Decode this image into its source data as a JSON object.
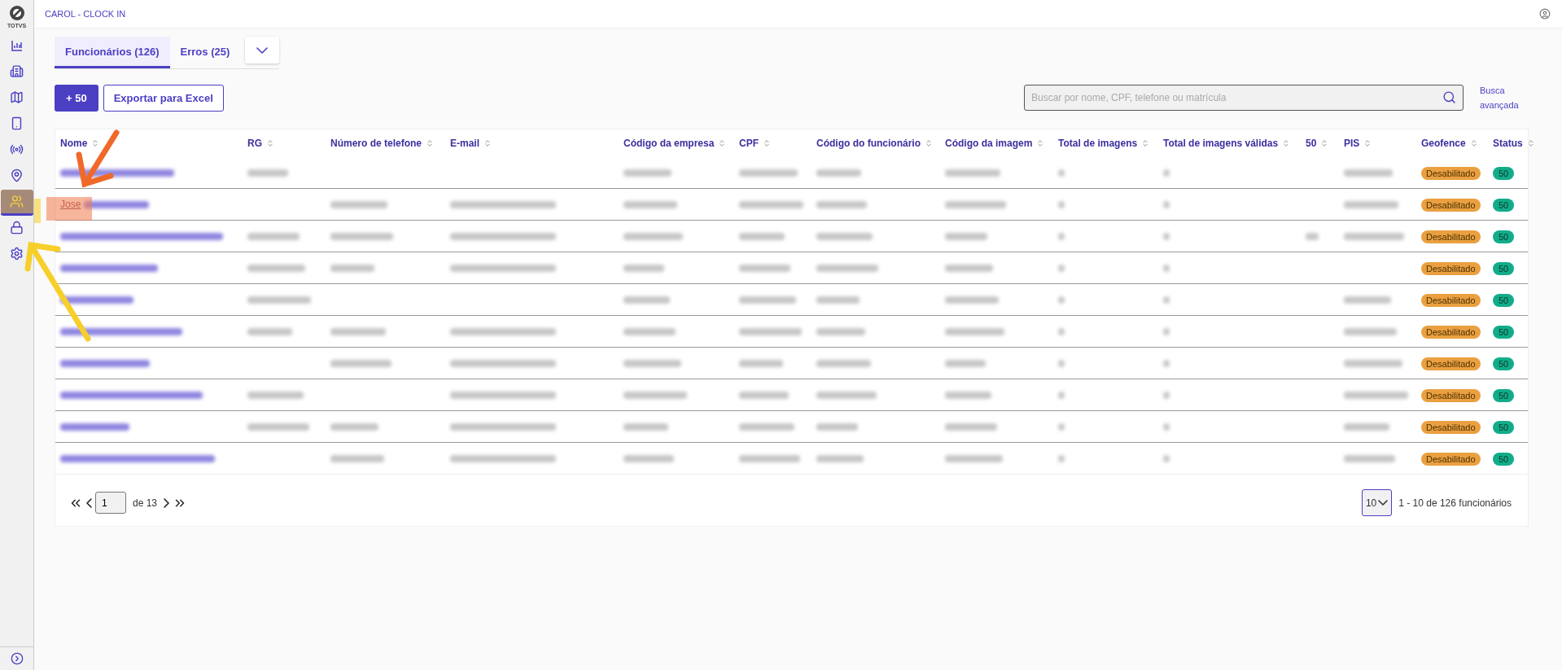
{
  "app": {
    "title": "CAROL - CLOCK IN",
    "logo_text": "TOTVS"
  },
  "sidebar": {
    "items": [
      {
        "selected": false
      },
      {
        "selected": false
      },
      {
        "selected": false
      },
      {
        "selected": false
      },
      {
        "selected": false
      },
      {
        "selected": false
      },
      {
        "selected": true
      },
      {
        "selected": false
      },
      {
        "selected": false
      }
    ]
  },
  "tabs": [
    {
      "label": "Funcionários (126)",
      "selected": true
    },
    {
      "label": "Erros (25)",
      "selected": false
    }
  ],
  "toolbar": {
    "add_button": "+ 50",
    "export_button": "Exportar para Excel",
    "search_placeholder": "Buscar por nome, CPF, telefone ou matrícula",
    "advanced_search": "Busca avançada"
  },
  "table": {
    "columns": [
      "Nome",
      "RG",
      "Número de telefone",
      "E-mail",
      "Código da empresa",
      "CPF",
      "Código do funcionário",
      "Código da imagem",
      "Total de imagens",
      "Total de imagens válidas",
      "50",
      "PIS",
      "Geofence",
      "Status"
    ],
    "rows": [
      {
        "name_visible": null,
        "filled": [
          true,
          false,
          false,
          true,
          true,
          true,
          true,
          true,
          true,
          false,
          true
        ],
        "geofence": "Desabilitado",
        "status": "50"
      },
      {
        "name_visible": "Jose",
        "filled": [
          false,
          true,
          true,
          true,
          true,
          true,
          true,
          true,
          true,
          false,
          true
        ],
        "geofence": "Desabilitado",
        "status": "50"
      },
      {
        "name_visible": null,
        "filled": [
          true,
          true,
          true,
          true,
          true,
          true,
          true,
          true,
          true,
          true,
          true
        ],
        "geofence": "Desabilitado",
        "status": "50"
      },
      {
        "name_visible": null,
        "filled": [
          true,
          true,
          true,
          true,
          true,
          true,
          true,
          true,
          true,
          false,
          false
        ],
        "geofence": "Desabilitado",
        "status": "50"
      },
      {
        "name_visible": null,
        "filled": [
          true,
          false,
          false,
          true,
          true,
          true,
          true,
          true,
          true,
          false,
          true
        ],
        "geofence": "Desabilitado",
        "status": "50"
      },
      {
        "name_visible": null,
        "filled": [
          true,
          true,
          true,
          true,
          true,
          true,
          true,
          true,
          true,
          false,
          true
        ],
        "geofence": "Desabilitado",
        "status": "50"
      },
      {
        "name_visible": null,
        "filled": [
          false,
          true,
          true,
          true,
          true,
          true,
          true,
          true,
          true,
          false,
          true
        ],
        "geofence": "Desabilitado",
        "status": "50"
      },
      {
        "name_visible": null,
        "filled": [
          true,
          false,
          true,
          true,
          true,
          true,
          true,
          true,
          true,
          false,
          true
        ],
        "geofence": "Desabilitado",
        "status": "50"
      },
      {
        "name_visible": null,
        "filled": [
          true,
          true,
          true,
          true,
          true,
          true,
          true,
          true,
          true,
          false,
          true
        ],
        "geofence": "Desabilitado",
        "status": "50"
      },
      {
        "name_visible": null,
        "filled": [
          false,
          true,
          true,
          true,
          true,
          true,
          true,
          true,
          true,
          false,
          true
        ],
        "geofence": "Desabilitado",
        "status": "50"
      }
    ]
  },
  "pagination": {
    "page": "1",
    "of_text": "de 13",
    "page_size": "10",
    "summary": "1 - 10 de 126 funcionários"
  }
}
